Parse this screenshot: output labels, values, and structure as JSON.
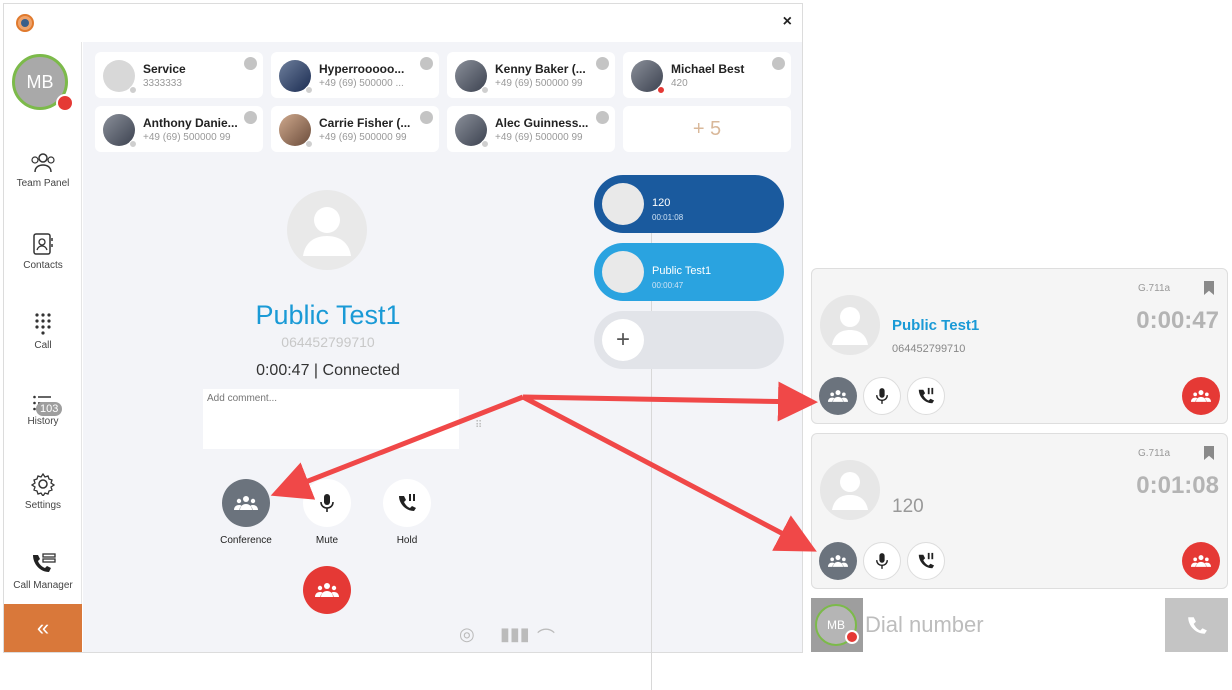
{
  "window": {
    "close_label": "×"
  },
  "user": {
    "initials": "MB"
  },
  "sidebar": {
    "items": [
      {
        "label": "Team Panel",
        "icon": "team-icon"
      },
      {
        "label": "Contacts",
        "icon": "contacts-icon"
      },
      {
        "label": "Call",
        "icon": "dialpad-icon"
      },
      {
        "label": "History",
        "icon": "history-icon"
      },
      {
        "label": "Settings",
        "icon": "gear-icon"
      },
      {
        "label": "Call Manager",
        "icon": "call-manager-icon"
      }
    ],
    "history_badge": "103",
    "collapse_label": "«"
  },
  "contacts": [
    {
      "name": "Service",
      "number": "3333333"
    },
    {
      "name": "Hyperrooooo...",
      "number": "+49 (69) 500000 ..."
    },
    {
      "name": "Kenny Baker (...",
      "number": "+49 (69) 500000 99"
    },
    {
      "name": "Michael Best",
      "number": "420"
    },
    {
      "name": "Anthony Danie...",
      "number": "+49 (69) 500000 99"
    },
    {
      "name": "Carrie Fisher (...",
      "number": "+49 (69) 500000 99"
    },
    {
      "name": "Alec Guinness...",
      "number": "+49 (69) 500000 99"
    }
  ],
  "contacts_more": "+ 5",
  "active_call": {
    "name": "Public Test1",
    "number": "064452799710",
    "status": "0:00:47 | Connected",
    "comment_placeholder": "Add comment...",
    "buttons": {
      "conference": "Conference",
      "mute": "Mute",
      "hold": "Hold"
    }
  },
  "call_tabs": [
    {
      "name": "120",
      "time": "00:01:08"
    },
    {
      "name": "Public Test1",
      "time": "00:00:47"
    }
  ],
  "mini_calls": [
    {
      "name": "Public Test1",
      "number": "064452799710",
      "codec": "G.711a",
      "time": "0:00:47"
    },
    {
      "name": "120",
      "number": "",
      "codec": "G.711a",
      "time": "0:01:08"
    }
  ],
  "dial": {
    "initials": "MB",
    "placeholder": "Dial number"
  },
  "colors": {
    "accent_blue": "#1a9ad6",
    "tab_dark": "#1a5a9e",
    "tab_light": "#2aa3e0",
    "hangup_red": "#e53935",
    "conference_gray": "#6b737d",
    "arrow_red": "#f04848",
    "collapse_orange": "#d9783a"
  }
}
